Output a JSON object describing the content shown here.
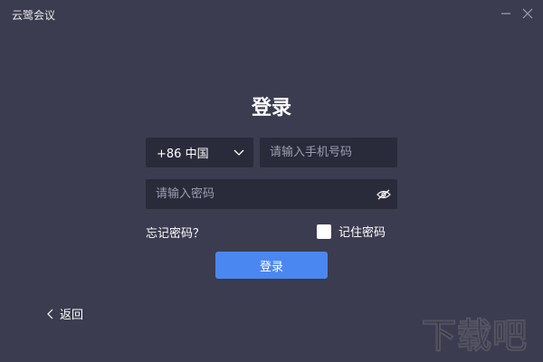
{
  "window": {
    "title": "云鹭会议"
  },
  "login": {
    "heading": "登录",
    "country_code": "+86 中国",
    "phone_placeholder": "请输入手机号码",
    "password_placeholder": "请输入密码",
    "forgot_password": "忘记密码？",
    "remember_password": "记住密码",
    "remember_checked": false,
    "login_button": "登录",
    "back": "返回"
  },
  "watermark": "下载吧",
  "colors": {
    "background": "#3b3c4f",
    "field": "#2a2b3a",
    "accent": "#4b87f0",
    "placeholder": "#9c9db0"
  }
}
